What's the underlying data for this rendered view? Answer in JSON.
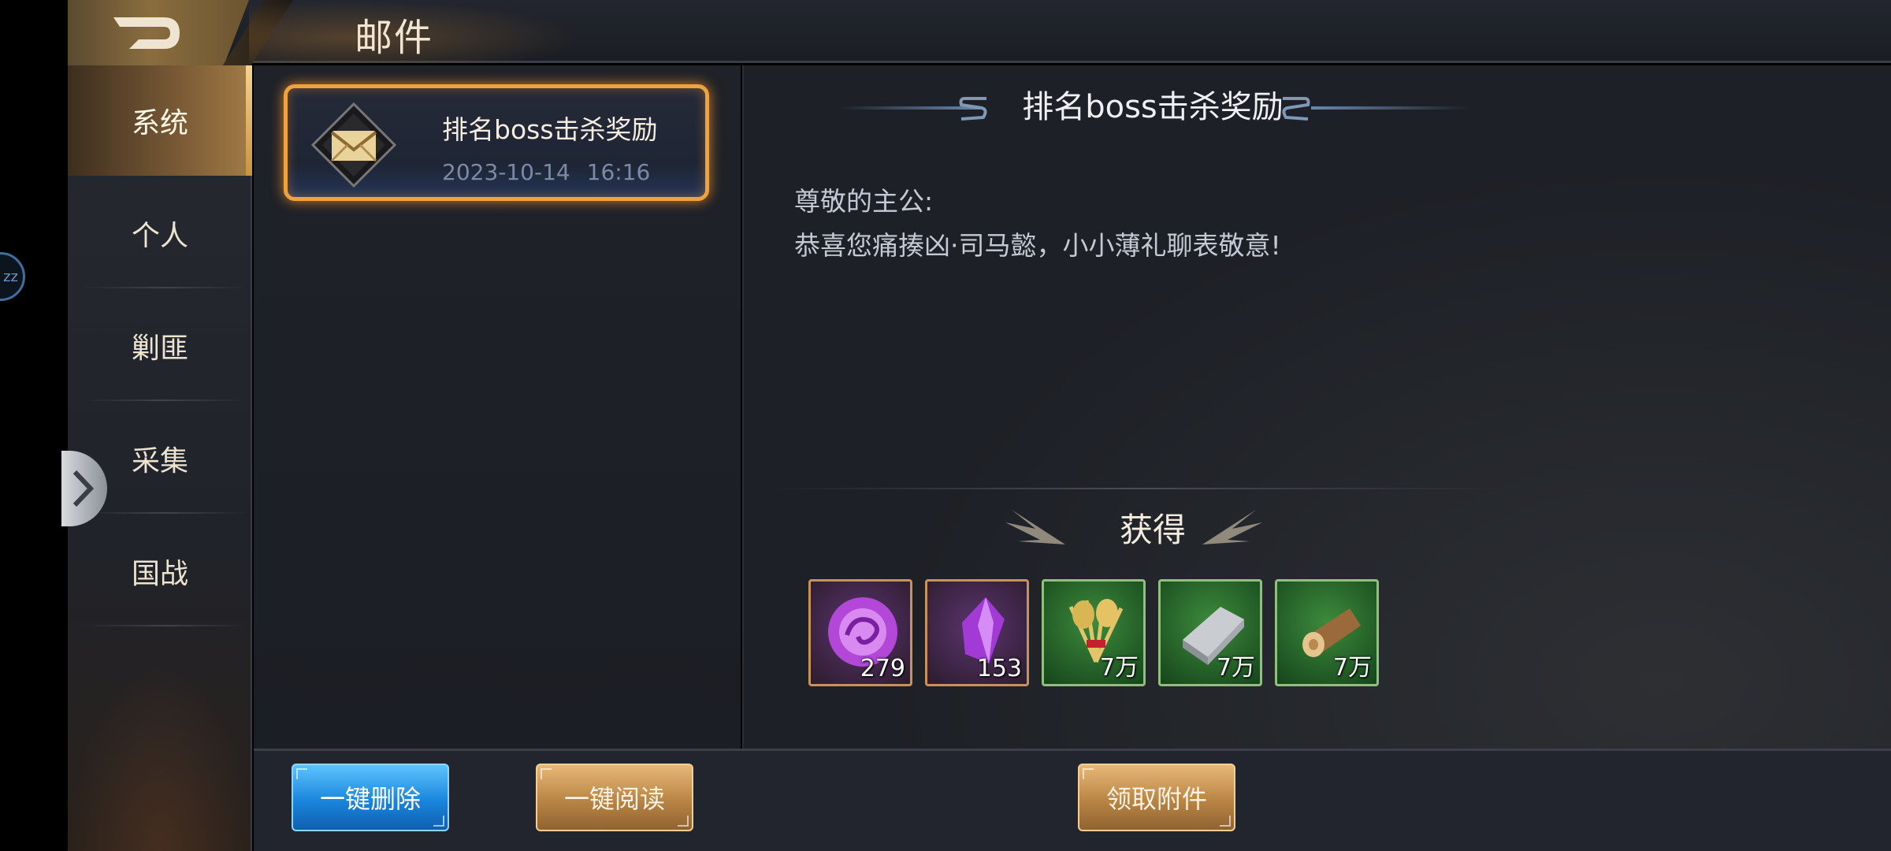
{
  "header": {
    "title": "邮件"
  },
  "overlay": {
    "badge_text": "zz"
  },
  "sidebar": {
    "items": [
      {
        "label": "系统",
        "active": true
      },
      {
        "label": "个人",
        "active": false
      },
      {
        "label": "剿匪",
        "active": false
      },
      {
        "label": "采集",
        "active": false
      },
      {
        "label": "国战",
        "active": false
      }
    ]
  },
  "mail_list": {
    "items": [
      {
        "title": "排名boss击杀奖励",
        "date": "2023-10-14 16:16",
        "selected": true,
        "icon": "envelope-icon"
      }
    ]
  },
  "detail": {
    "title": "排名boss击杀奖励",
    "greeting": "尊敬的主公:",
    "body": "恭喜您痛揍凶·司马懿，小小薄礼聊表敬意!",
    "rewards_label": "获得",
    "rewards": [
      {
        "icon": "purple-orb-icon",
        "qty": "279"
      },
      {
        "icon": "purple-crystal-icon",
        "qty": "153"
      },
      {
        "icon": "grain-bundle-icon",
        "qty": "7万"
      },
      {
        "icon": "iron-ingot-icon",
        "qty": "7万"
      },
      {
        "icon": "wood-log-icon",
        "qty": "7万"
      }
    ]
  },
  "actions": {
    "delete_all": "一键删除",
    "read_all": "一键阅读",
    "claim": "领取附件"
  },
  "colors": {
    "accent_gold": "#f0a23c",
    "button_blue": "#1a86dc",
    "button_gold": "#b98545"
  }
}
